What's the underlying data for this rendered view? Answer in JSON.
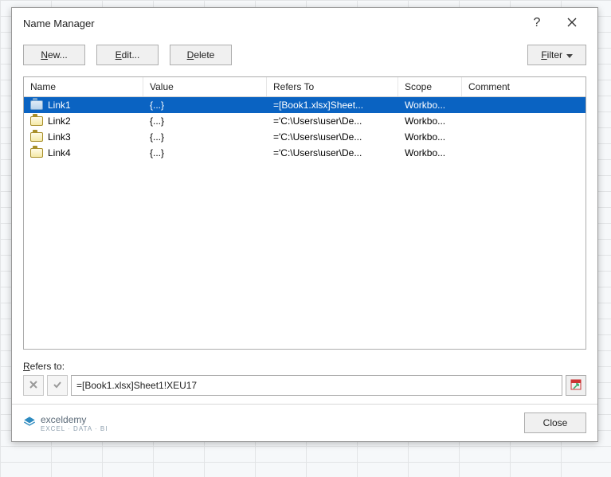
{
  "dialog": {
    "title": "Name Manager"
  },
  "toolbar": {
    "new_label": "New...",
    "edit_label": "Edit...",
    "delete_label": "Delete",
    "filter_label": "Filter"
  },
  "columns": {
    "name": "Name",
    "value": "Value",
    "refers_to": "Refers To",
    "scope": "Scope",
    "comment": "Comment"
  },
  "rows": [
    {
      "name": "Link1",
      "value": "{...}",
      "refers_to": "=[Book1.xlsx]Sheet...",
      "scope": "Workbo...",
      "comment": "",
      "selected": true
    },
    {
      "name": "Link2",
      "value": "{...}",
      "refers_to": "='C:\\Users\\user\\De...",
      "scope": "Workbo...",
      "comment": "",
      "selected": false
    },
    {
      "name": "Link3",
      "value": "{...}",
      "refers_to": "='C:\\Users\\user\\De...",
      "scope": "Workbo...",
      "comment": "",
      "selected": false
    },
    {
      "name": "Link4",
      "value": "{...}",
      "refers_to": "='C:\\Users\\user\\De...",
      "scope": "Workbo...",
      "comment": "",
      "selected": false
    }
  ],
  "refers": {
    "label": "Refers to:",
    "value": "=[Book1.xlsx]Sheet1!XEU17"
  },
  "footer": {
    "close_label": "Close"
  },
  "brand": {
    "name": "exceldemy",
    "sub": "EXCEL · DATA · BI"
  }
}
